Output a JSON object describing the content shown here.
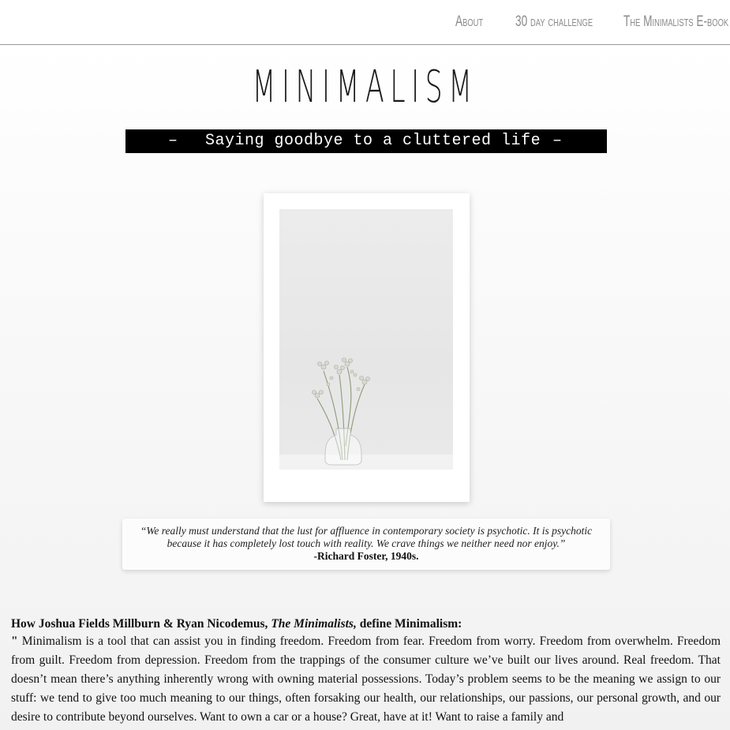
{
  "nav": {
    "items": [
      {
        "label": "About"
      },
      {
        "label": "30 day challenge"
      },
      {
        "label": "The Minimalists E-book"
      }
    ]
  },
  "header": {
    "title": "Minimalism",
    "tagline_dash_left": "–",
    "tagline": "Saying goodbye to a cluttered life",
    "tagline_dash_right": "–"
  },
  "hero_image": {
    "icon": "flower-vase-photo"
  },
  "quote": {
    "text": "“We really must understand that the lust for affluence in contemporary society is psychotic. It is psychotic because it has completely lost touch with reality. We crave things we neither need nor enjoy.”",
    "author": "-Richard Foster, 1940s."
  },
  "article": {
    "heading_prefix": "How Joshua Fields Millburn & Ryan Nicodemus, ",
    "heading_italic": "The Minimalists,",
    "heading_suffix": " define Minimalism:",
    "open_quote_mark": "\"",
    "body": " Minimalism is a tool that can assist you in finding freedom. Freedom from fear. Freedom from worry. Freedom from overwhelm. Freedom from guilt. Freedom from depression. Freedom from the trappings of the consumer culture we’ve built our lives around. Real freedom. That doesn’t mean there’s anything inherently wrong with owning material possessions. Today’s problem seems to be the meaning we assign to our stuff: we tend to give too much meaning to our things, often forsaking our health, our relationships, our passions, our personal growth, and our desire to contribute beyond ourselves. Want to own a car or a house? Great, have at it! Want to raise a family and"
  },
  "colors": {
    "nav_text": "#8a8a8a",
    "tagline_bg": "#000000",
    "tagline_text": "#ffffff"
  }
}
